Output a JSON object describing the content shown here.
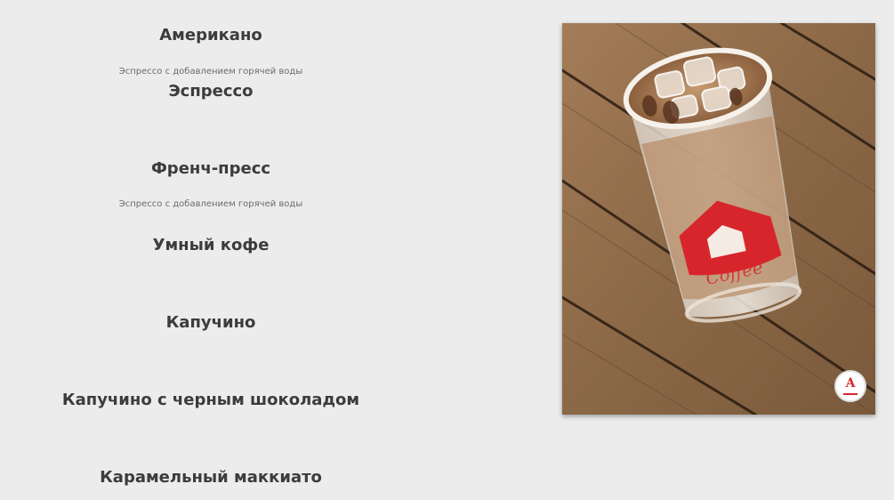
{
  "menu": {
    "items": [
      {
        "title": "Американо",
        "description": "Эспрессо с добавлением горячей воды"
      },
      {
        "title": "Эспрессо",
        "description": ""
      },
      {
        "title": "Френч-пресс",
        "description": "Эспрессо с добавлением горячей воды"
      },
      {
        "title": "Умный кофе",
        "description": ""
      },
      {
        "title": "Капучино",
        "description": ""
      },
      {
        "title": "Капучино с черным шоколадом",
        "description": ""
      },
      {
        "title": "Карамельный маккиато",
        "description": ""
      }
    ]
  },
  "photo": {
    "subject": "iced coffee glass on wooden table",
    "brand_letter": "A"
  },
  "colors": {
    "background": "#ececec",
    "text": "#3c3c3c",
    "brand_red": "#d7262b"
  }
}
